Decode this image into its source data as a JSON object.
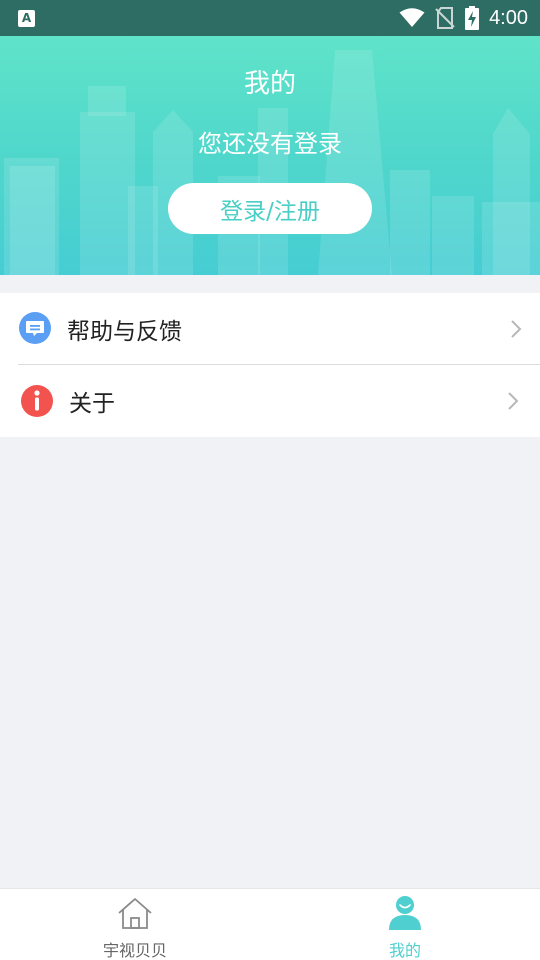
{
  "status_bar": {
    "app_icon_letter": "A",
    "time": "4:00",
    "icons": [
      "app-notification-icon",
      "wifi-icon",
      "no-sim-icon",
      "battery-charging-icon"
    ]
  },
  "header": {
    "title": "我的",
    "subtitle": "您还没有登录",
    "login_button": "登录/注册",
    "colors": {
      "gradient_top": "#5fe3c9",
      "gradient_bottom": "#45cdd3",
      "button_text": "#49cfc6"
    }
  },
  "menu": {
    "items": [
      {
        "label": "帮助与反馈",
        "icon": "chat-bubble-icon",
        "icon_color": "#5b9ff5"
      },
      {
        "label": "关于",
        "icon": "info-icon",
        "icon_color": "#f2534f"
      }
    ]
  },
  "tabbar": {
    "tabs": [
      {
        "label": "宇视贝贝",
        "icon": "home-icon",
        "active": false
      },
      {
        "label": "我的",
        "icon": "user-icon",
        "active": true
      }
    ],
    "active_color": "#4fcfcf"
  }
}
